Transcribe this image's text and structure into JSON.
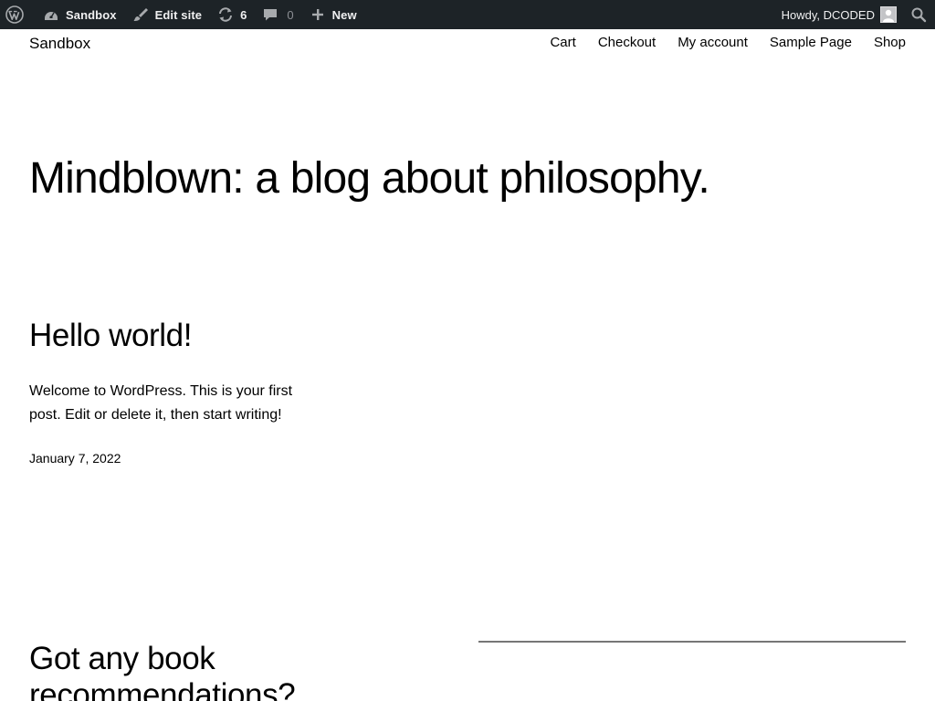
{
  "admin_bar": {
    "wp_logo_icon": "wordpress-logo-icon",
    "site_name": "Sandbox",
    "edit_site": "Edit site",
    "updates_count": "6",
    "comments_count": "0",
    "new_label": "New",
    "howdy": "Howdy, DCODED",
    "colors": {
      "background": "#1d2327",
      "text": "#f0f0f1",
      "muted": "#8c8f94"
    }
  },
  "site": {
    "title": "Sandbox",
    "nav": [
      "Cart",
      "Checkout",
      "My account",
      "Sample Page",
      "Shop"
    ]
  },
  "hero": {
    "heading": "Mindblown: a blog about philosophy."
  },
  "posts": [
    {
      "title": "Hello world!",
      "excerpt": "Welcome to WordPress. This is your first post. Edit or delete it, then start writing!",
      "date": "January 7, 2022"
    },
    {
      "title": "Got any book recommendations?"
    }
  ]
}
